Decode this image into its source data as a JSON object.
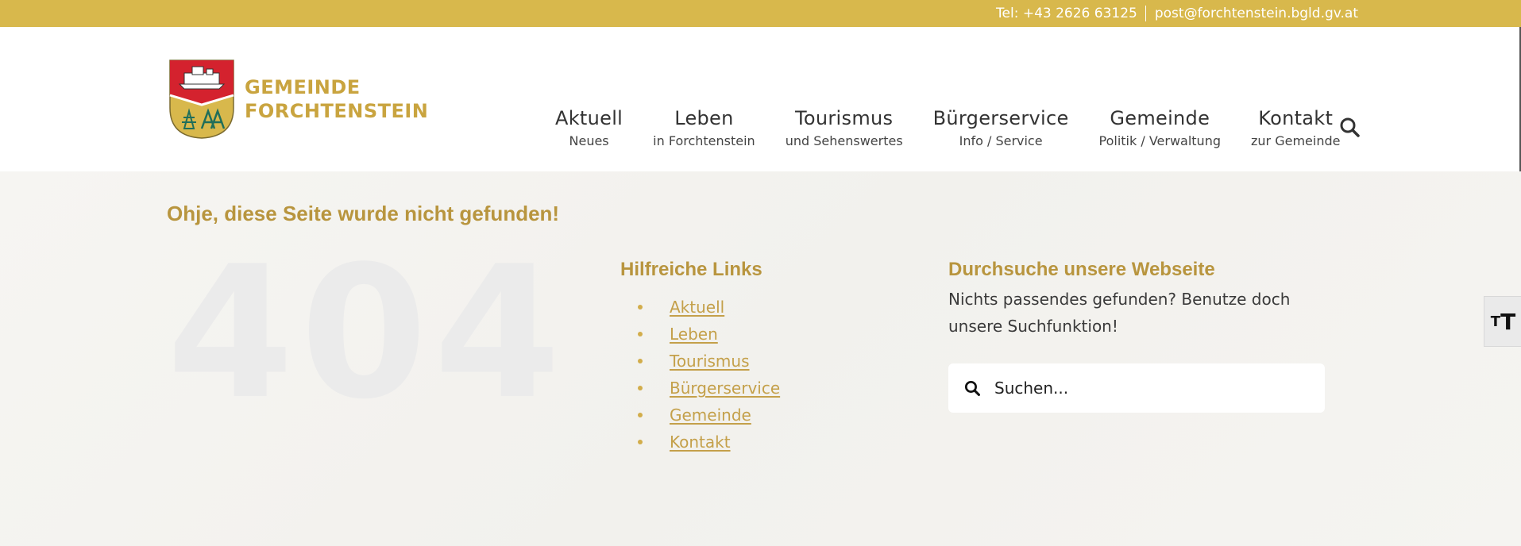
{
  "topbar": {
    "phone": "Tel: +43 2626 63125",
    "email": "post@forchtenstein.bgld.gv.at"
  },
  "logo": {
    "line1": "GEMEINDE",
    "line2": "FORCHTENSTEIN"
  },
  "nav": [
    {
      "main": "Aktuell",
      "sub": "Neues"
    },
    {
      "main": "Leben",
      "sub": "in Forchtenstein"
    },
    {
      "main": "Tourismus",
      "sub": "und Sehenswertes"
    },
    {
      "main": "Bürgerservice",
      "sub": "Info / Service"
    },
    {
      "main": "Gemeinde",
      "sub": "Politik / Verwaltung"
    },
    {
      "main": "Kontakt",
      "sub": "zur Gemeinde"
    }
  ],
  "error": {
    "title": "Ohje, diese Seite wurde nicht gefunden!",
    "code": "404"
  },
  "links": {
    "title": "Hilfreiche Links",
    "items": [
      "Aktuell",
      "Leben",
      "Tourismus",
      "Bürgerservice",
      "Gemeinde",
      "Kontakt"
    ]
  },
  "search": {
    "title": "Durchsuche unsere Webseite",
    "text": "Nichts passendes gefunden? Benutze doch unsere Suchfunktion!",
    "placeholder": "Suchen..."
  },
  "font_tool": {
    "small": "T",
    "big": "T"
  },
  "colors": {
    "gold": "#d8b84c",
    "accent_text": "#b8953e"
  },
  "icons": {
    "search": "search-icon",
    "crest": "crest-icon",
    "font_size": "font-size-icon"
  }
}
